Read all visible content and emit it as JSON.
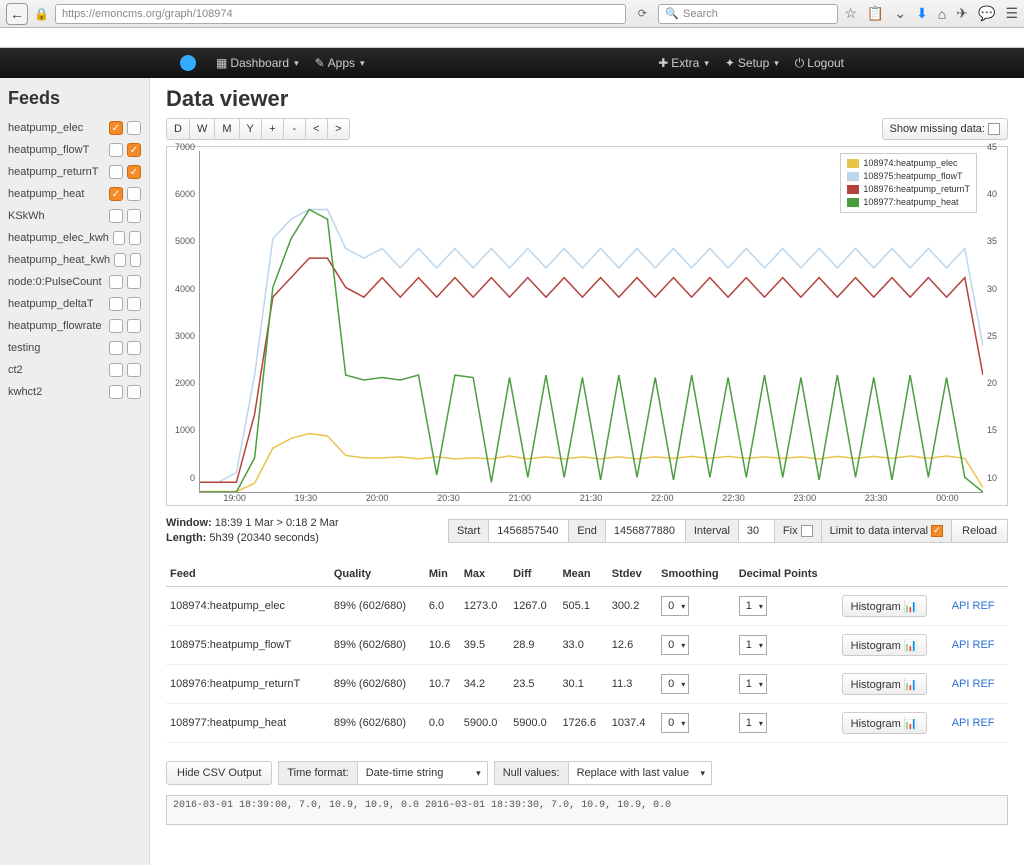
{
  "browser": {
    "url": "https://emoncms.org/graph/108974",
    "search_placeholder": "Search"
  },
  "nav": {
    "dashboard": "Dashboard",
    "apps": "Apps",
    "extra": "Extra",
    "setup": "Setup",
    "logout": "Logout"
  },
  "sidebar": {
    "title": "Feeds",
    "items": [
      {
        "name": "heatpump_elec",
        "left": true,
        "right": false
      },
      {
        "name": "heatpump_flowT",
        "left": false,
        "right": true
      },
      {
        "name": "heatpump_returnT",
        "left": false,
        "right": true
      },
      {
        "name": "heatpump_heat",
        "left": true,
        "right": false
      },
      {
        "name": "KSkWh",
        "left": false,
        "right": false
      },
      {
        "name": "heatpump_elec_kwh",
        "left": false,
        "right": false
      },
      {
        "name": "heatpump_heat_kwh",
        "left": false,
        "right": false
      },
      {
        "name": "node:0:PulseCount",
        "left": false,
        "right": false
      },
      {
        "name": "heatpump_deltaT",
        "left": false,
        "right": false
      },
      {
        "name": "heatpump_flowrate",
        "left": false,
        "right": false
      },
      {
        "name": "testing",
        "left": false,
        "right": false
      },
      {
        "name": "ct2",
        "left": false,
        "right": false
      },
      {
        "name": "kwhct2",
        "left": false,
        "right": false
      }
    ]
  },
  "main": {
    "title": "Data viewer",
    "range_buttons": [
      "D",
      "W",
      "M",
      "Y",
      "+",
      "-",
      "<",
      ">"
    ],
    "show_missing": "Show missing data:",
    "legend": [
      {
        "label": "108974:heatpump_elec",
        "color": "#e8c34a"
      },
      {
        "label": "108975:heatpump_flowT",
        "color": "#bcd6ec"
      },
      {
        "label": "108976:heatpump_returnT",
        "color": "#b4433d"
      },
      {
        "label": "108977:heatpump_heat",
        "color": "#4a9e3e"
      }
    ],
    "window_label": "Window:",
    "window_value": "18:39 1 Mar > 0:18 2 Mar",
    "length_label": "Length:",
    "length_value": "5h39 (20340 seconds)",
    "params": {
      "start_lbl": "Start",
      "start_val": "1456857540",
      "end_lbl": "End",
      "end_val": "1456877880",
      "interval_lbl": "Interval",
      "interval_val": "30",
      "fix_lbl": "Fix",
      "limit_lbl": "Limit to data interval",
      "reload": "Reload"
    },
    "table": {
      "headers": [
        "Feed",
        "Quality",
        "Min",
        "Max",
        "Diff",
        "Mean",
        "Stdev",
        "Smoothing",
        "Decimal Points",
        "",
        ""
      ],
      "rows": [
        {
          "feed": "108974:heatpump_elec",
          "quality": "89% (602/680)",
          "min": "6.0",
          "max": "1273.0",
          "diff": "1267.0",
          "mean": "505.1",
          "stdev": "300.2",
          "smooth": "0",
          "dp": "1"
        },
        {
          "feed": "108975:heatpump_flowT",
          "quality": "89% (602/680)",
          "min": "10.6",
          "max": "39.5",
          "diff": "28.9",
          "mean": "33.0",
          "stdev": "12.6",
          "smooth": "0",
          "dp": "1"
        },
        {
          "feed": "108976:heatpump_returnT",
          "quality": "89% (602/680)",
          "min": "10.7",
          "max": "34.2",
          "diff": "23.5",
          "mean": "30.1",
          "stdev": "11.3",
          "smooth": "0",
          "dp": "1"
        },
        {
          "feed": "108977:heatpump_heat",
          "quality": "89% (602/680)",
          "min": "0.0",
          "max": "5900.0",
          "diff": "5900.0",
          "mean": "1726.6",
          "stdev": "1037.4",
          "smooth": "0",
          "dp": "1"
        }
      ],
      "histogram": "Histogram",
      "api": "API REF"
    },
    "csv": {
      "hide": "Hide CSV Output",
      "time_format_lbl": "Time format:",
      "time_format_val": "Date-time string",
      "null_lbl": "Null values:",
      "null_val": "Replace with last value",
      "output": "2016-03-01 18:39:00, 7.0, 10.9, 10.9, 0.0\n2016-03-01 18:39:30, 7.0, 10.9, 10.9, 0.0"
    }
  },
  "chart_data": {
    "type": "line",
    "x_ticks": [
      "19:00",
      "19:30",
      "20:00",
      "20:30",
      "21:00",
      "21:30",
      "22:00",
      "22:30",
      "23:00",
      "23:30",
      "00:00"
    ],
    "y_left": {
      "min": 0,
      "max": 7000,
      "ticks": [
        0,
        1000,
        2000,
        3000,
        4000,
        5000,
        6000,
        7000
      ]
    },
    "y_right": {
      "min": 10,
      "max": 45,
      "ticks": [
        10,
        15,
        20,
        25,
        30,
        35,
        40,
        45
      ]
    },
    "series": [
      {
        "name": "heatpump_elec",
        "axis": "left",
        "color": "#e8c34a",
        "values": [
          10,
          10,
          10,
          180,
          900,
          1100,
          1200,
          1150,
          750,
          700,
          700,
          720,
          680,
          720,
          680,
          700,
          680,
          740,
          680,
          720,
          680,
          720,
          680,
          720,
          680,
          720,
          690,
          730,
          690,
          730,
          690,
          720,
          690,
          720,
          680,
          730,
          690,
          730,
          690,
          740,
          690,
          740,
          690,
          90
        ]
      },
      {
        "name": "heatpump_flowT",
        "axis": "right",
        "color": "#bcd6ec",
        "values": [
          11,
          11,
          12,
          22,
          36,
          38,
          39,
          39,
          35,
          34,
          35,
          33,
          35,
          33,
          35,
          33,
          35,
          33,
          35,
          33,
          35,
          33,
          35,
          33,
          35,
          33,
          35,
          33,
          35,
          33,
          35,
          33,
          35,
          33,
          35,
          33,
          35,
          33,
          35,
          33,
          35,
          33,
          35,
          25
        ]
      },
      {
        "name": "heatpump_returnT",
        "axis": "right",
        "color": "#b4433d",
        "values": [
          11,
          11,
          11,
          18,
          30,
          32,
          34,
          34,
          31,
          30,
          32,
          30,
          32,
          30,
          32,
          30,
          32,
          30,
          32,
          30,
          32,
          30,
          32,
          30,
          32,
          30,
          32,
          30,
          32,
          30,
          32,
          30,
          32,
          30,
          32,
          30,
          32,
          30,
          32,
          30,
          32,
          30,
          32,
          22
        ]
      },
      {
        "name": "heatpump_heat",
        "axis": "left",
        "color": "#4a9e3e",
        "values": [
          0,
          0,
          0,
          700,
          4200,
          5200,
          5800,
          5600,
          2400,
          2300,
          2350,
          2300,
          2400,
          350,
          2400,
          2350,
          200,
          2350,
          300,
          2400,
          300,
          2350,
          250,
          2400,
          300,
          2350,
          250,
          2400,
          300,
          2350,
          300,
          2400,
          300,
          2350,
          250,
          2400,
          300,
          2350,
          250,
          2400,
          300,
          2350,
          300,
          0
        ]
      }
    ]
  }
}
